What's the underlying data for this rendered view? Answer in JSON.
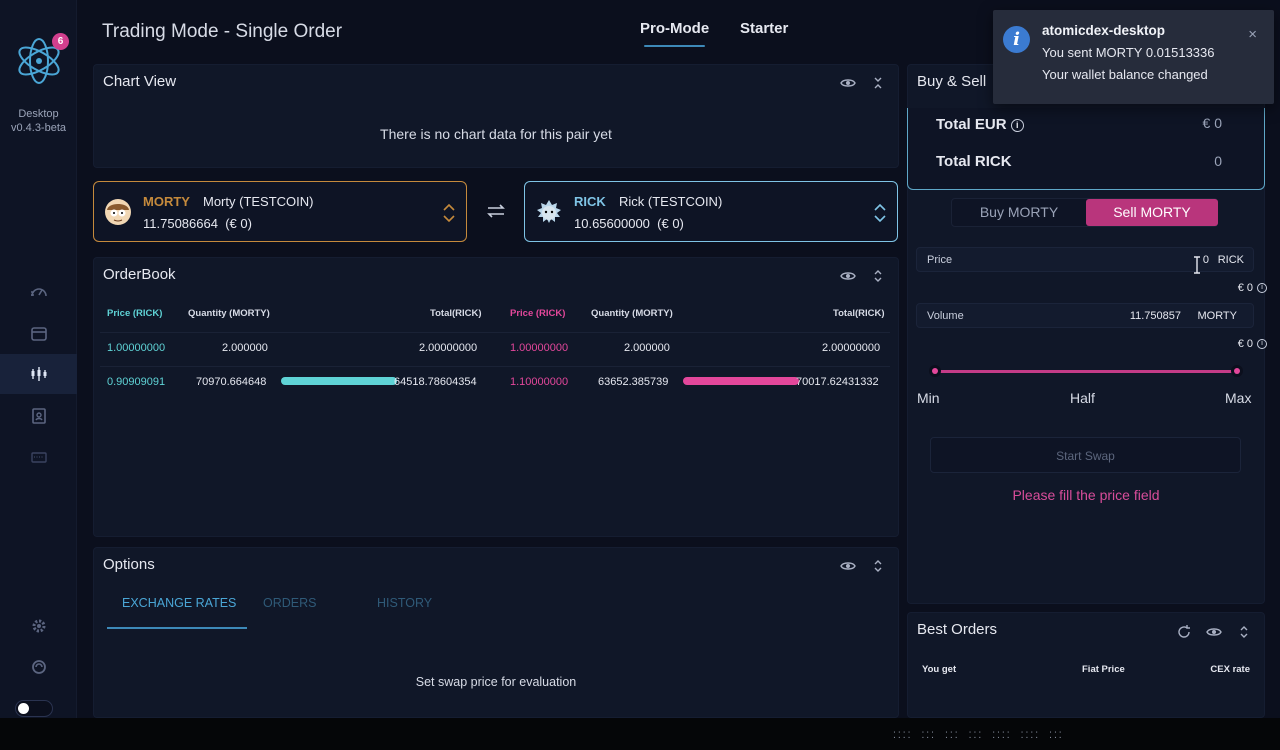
{
  "app": {
    "title": "Trading Mode - Single Order",
    "brand_line1": "Desktop",
    "brand_line2": "v0.4.3-beta",
    "notification_count": "6",
    "mode_tabs": [
      "Pro-Mode",
      "Starter"
    ]
  },
  "chart": {
    "title": "Chart View",
    "empty_msg": "There is no chart data for this pair yet"
  },
  "pair": {
    "left": {
      "symbol": "MORTY",
      "name": "Morty (TESTCOIN)",
      "balance": "11.75086664",
      "fiat": "(€ 0)",
      "color": "#c58a3c"
    },
    "right": {
      "symbol": "RICK",
      "name": "Rick (TESTCOIN)",
      "balance": "10.65600000",
      "fiat": "(€ 0)",
      "color": "#7fc4e6"
    }
  },
  "orderbook": {
    "title": "OrderBook",
    "headers": [
      "Price (RICK)",
      "Quantity (MORTY)",
      "Total(RICK)",
      "Price (RICK)",
      "Quantity (MORTY)",
      "Total(RICK)"
    ],
    "bids": [
      {
        "price": "1.00000000",
        "qty": "2.000000",
        "total": "2.00000000",
        "depth": 0
      },
      {
        "price": "0.90909091",
        "qty": "70970.664648",
        "total": "64518.78604354",
        "depth": 1.0
      }
    ],
    "asks": [
      {
        "price": "1.00000000",
        "qty": "2.000000",
        "total": "2.00000000",
        "depth": 0
      },
      {
        "price": "1.10000000",
        "qty": "63652.385739",
        "total": "70017.62431332",
        "depth": 1.0
      }
    ],
    "bid_color": "#5fd3d6",
    "ask_color": "#e3479b"
  },
  "options": {
    "title": "Options",
    "tabs": [
      "EXCHANGE RATES",
      "ORDERS",
      "HISTORY"
    ],
    "empty_msg": "Set swap price for evaluation"
  },
  "buy_sell": {
    "title": "Buy & Sell",
    "total_eur_label": "Total EUR",
    "total_eur_val": "€ 0",
    "total_rick_label": "Total RICK",
    "total_rick_val": "0",
    "buy_btn": "Buy MORTY",
    "sell_btn": "Sell MORTY",
    "price_label": "Price",
    "price_value": "0",
    "price_unit": "RICK",
    "price_fiat": "€ 0",
    "volume_label": "Volume",
    "volume_value": "11.750857",
    "volume_unit": "MORTY",
    "volume_fiat": "€ 0",
    "slider_min": "Min",
    "slider_half": "Half",
    "slider_max": "Max",
    "slider_level": 1.0,
    "start_swap": "Start Swap",
    "warning": "Please fill the price field"
  },
  "best_orders": {
    "title": "Best Orders",
    "headers": [
      "You get",
      "Fiat Price",
      "CEX rate"
    ]
  },
  "notification": {
    "title": "atomicdex-desktop",
    "line1": "You sent MORTY 0.01513336",
    "line2": "Your wallet balance changed",
    "close": "×"
  }
}
